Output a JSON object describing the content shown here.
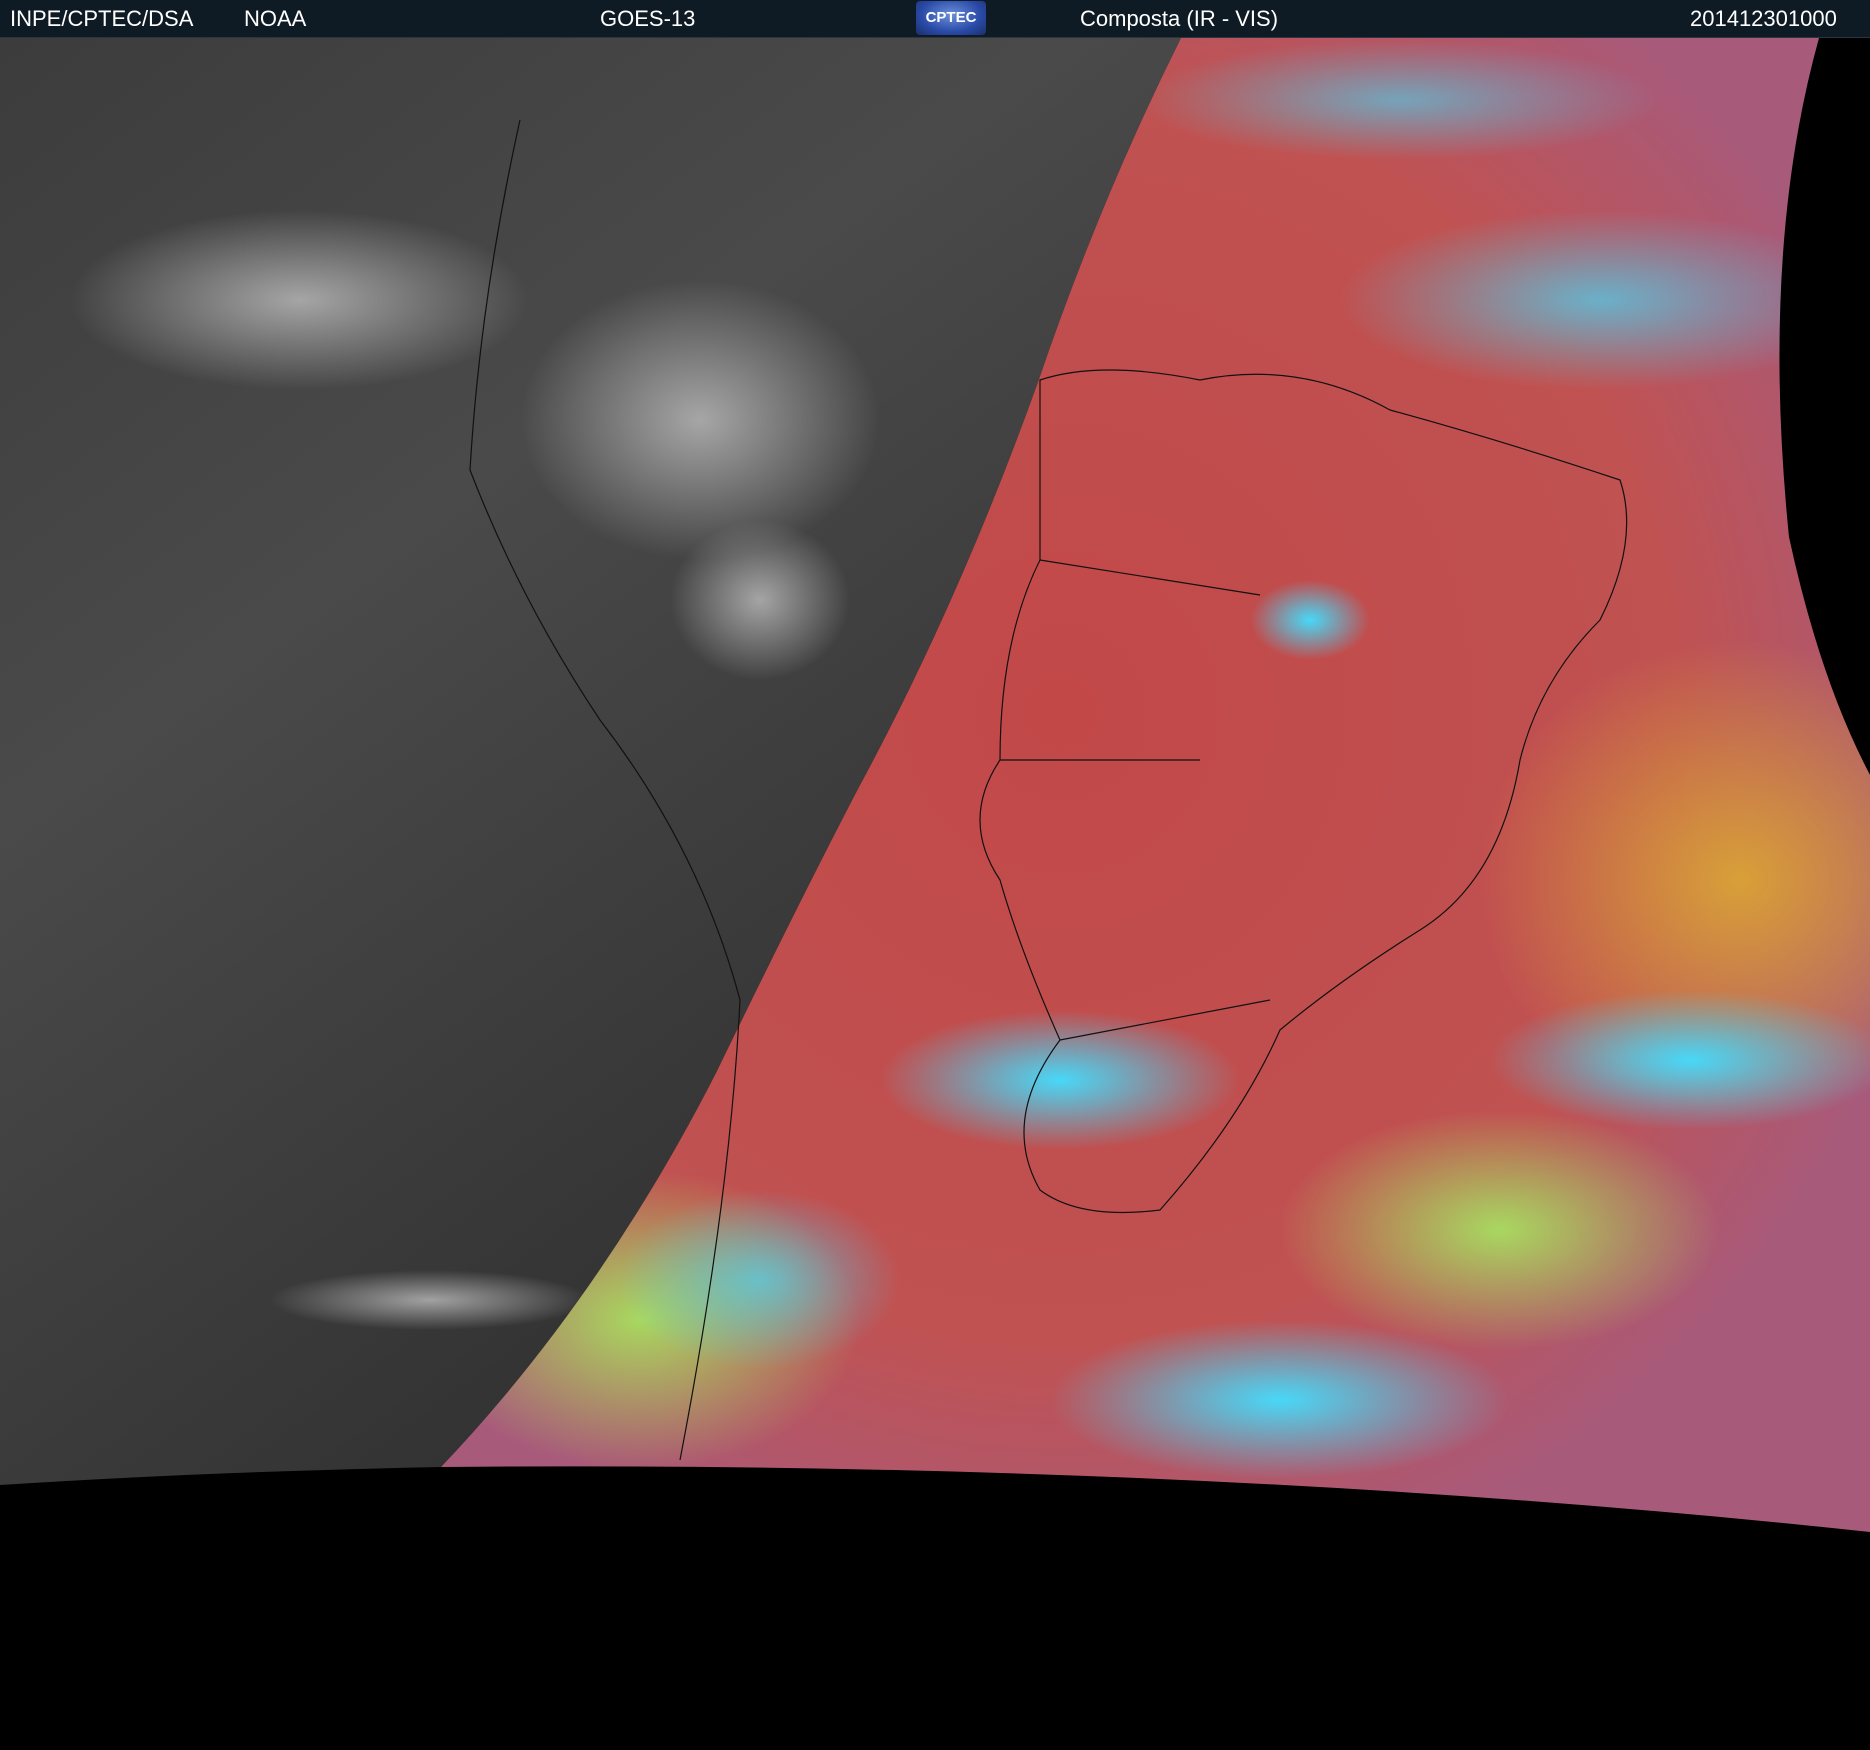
{
  "header": {
    "agency": "INPE/CPTEC/DSA",
    "source": "NOAA",
    "satellite": "GOES-13",
    "logo_text": "CPTEC",
    "product": "Composta (IR - VIS)",
    "timestamp": "201412301000"
  },
  "colors": {
    "header_bg": "#0f1b24",
    "ir_gray": "#3a3a3a",
    "vis_red": "#c85050",
    "cloud_cyan": "#40d0f0",
    "yellow": "#d0b040"
  }
}
